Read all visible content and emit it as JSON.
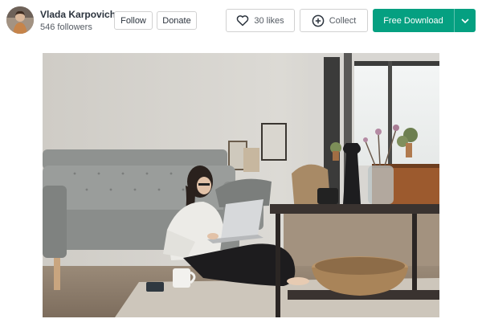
{
  "author": {
    "name": "Vlada Karpovich",
    "followers": "546 followers",
    "avatar_icon": "avatar-photo"
  },
  "actions": {
    "follow_label": "Follow",
    "donate_label": "Donate",
    "likes_label": "30 likes",
    "collect_label": "Collect",
    "download_label": "Free Download"
  },
  "icons": {
    "likes": "heart-icon",
    "collect": "plus-circle-icon",
    "download_menu": "chevron-down-icon"
  },
  "colors": {
    "accent": "#05a081",
    "text": "#2c343e",
    "border": "#d1d1d1"
  }
}
